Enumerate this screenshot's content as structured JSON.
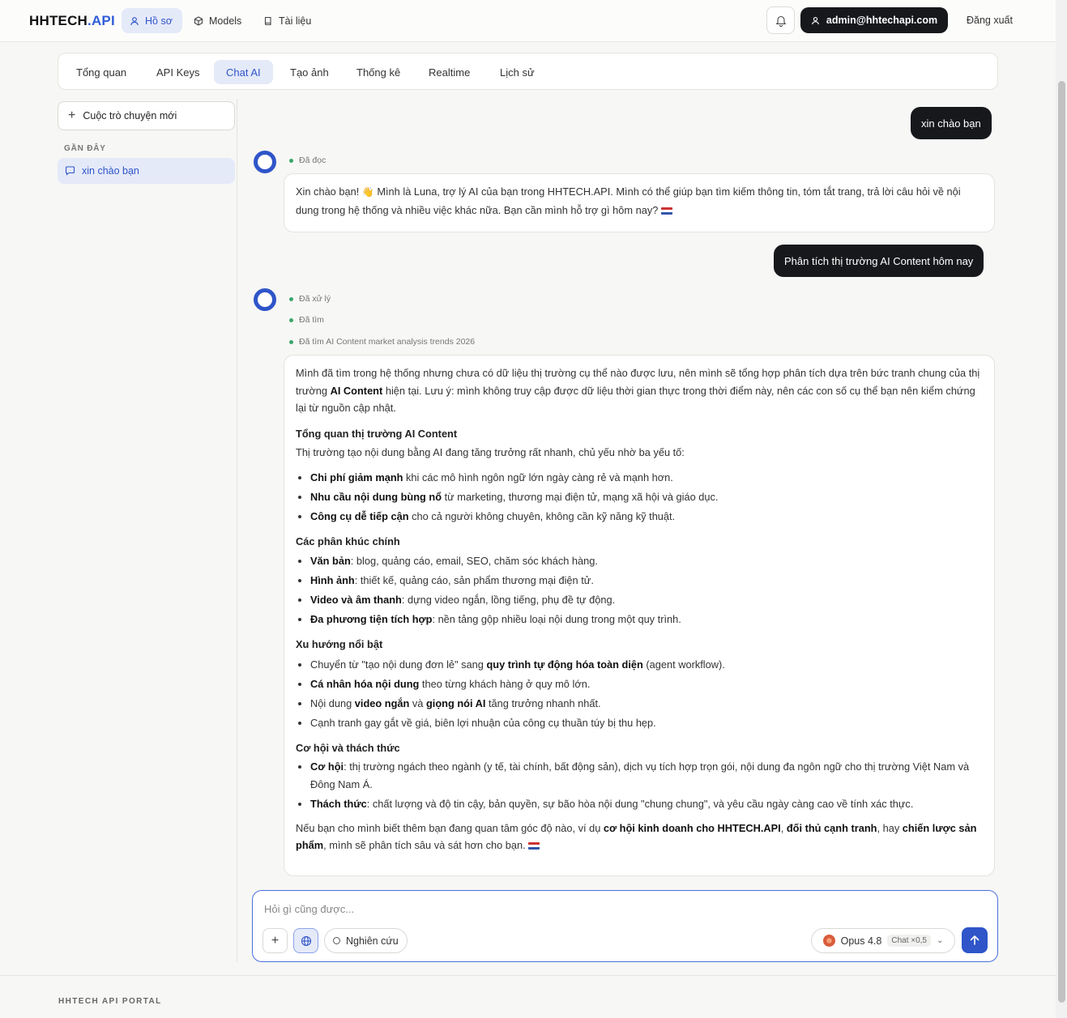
{
  "header": {
    "logo_main": "HHTECH",
    "logo_accent": ".API",
    "nav": [
      {
        "label": "Hồ sơ",
        "icon": "user-icon",
        "active": true
      },
      {
        "label": "Models",
        "icon": "cube-icon",
        "active": false
      },
      {
        "label": "Tài liệu",
        "icon": "book-icon",
        "active": false
      }
    ],
    "user_email": "admin@hhtechapi.com",
    "logout_label": "Đăng xuất"
  },
  "tabs": [
    {
      "label": "Tổng quan",
      "active": false
    },
    {
      "label": "API Keys",
      "active": false
    },
    {
      "label": "Chat AI",
      "active": true
    },
    {
      "label": "Tạo ảnh",
      "active": false
    },
    {
      "label": "Thống kê",
      "active": false
    },
    {
      "label": "Realtime",
      "active": false
    },
    {
      "label": "Lịch sử",
      "active": false
    }
  ],
  "sidebar": {
    "new_chat_label": "Cuộc trò chuyện mới",
    "recent_label": "GẦN ĐÂY",
    "recent_items": [
      "xin chào bạn"
    ]
  },
  "chat": {
    "user_msg_1": "xin chào bạn",
    "status_1": "Đã đọc",
    "assistant_1_a": "Xin chào bạn!",
    "assistant_1_b": "Mình là Luna, trợ lý AI của bạn trong HHTECH.API. Mình có thể giúp bạn tìm kiếm thông tin, tóm tắt trang, trả lời câu hỏi về nội dung trong hệ thống và nhiều việc khác nữa. Bạn cần mình hỗ trợ gì hôm nay?",
    "user_msg_2": "Phân tích thị trường AI Content hôm nay",
    "steps": [
      "Đã xử lý",
      "Đã tìm",
      "Đã tìm AI Content market analysis trends 2026"
    ],
    "answer": {
      "intro_1": "Mình đã tìm trong hệ thống nhưng chưa có dữ liệu thị trường cụ thể nào được lưu, nên mình sẽ tổng hợp phân tích dựa trên bức tranh chung của thị trường ",
      "intro_bold": "AI Content",
      "intro_2": " hiện tại. Lưu ý: mình không truy cập được dữ liệu thời gian thực trong thời điểm này, nên các con số cụ thể bạn nên kiểm chứng lại từ nguồn cập nhật.",
      "h1": "Tổng quan thị trường AI Content",
      "p1": "Thị trường tạo nội dung bằng AI đang tăng trưởng rất nhanh, chủ yếu nhờ ba yếu tố:",
      "l1": [
        {
          "b": "Chi phí giảm mạnh",
          "t": " khi các mô hình ngôn ngữ lớn ngày càng rẻ và mạnh hơn."
        },
        {
          "b": "Nhu cầu nội dung bùng nổ",
          "t": " từ marketing, thương mại điện tử, mạng xã hội và giáo dục."
        },
        {
          "b": "Công cụ dễ tiếp cận",
          "t": " cho cả người không chuyên, không cần kỹ năng kỹ thuật."
        }
      ],
      "h2": "Các phân khúc chính",
      "l2": [
        {
          "b": "Văn bản",
          "t": ": blog, quảng cáo, email, SEO, chăm sóc khách hàng."
        },
        {
          "b": "Hình ảnh",
          "t": ": thiết kế, quảng cáo, sản phẩm thương mại điện tử."
        },
        {
          "b": "Video và âm thanh",
          "t": ": dựng video ngắn, lồng tiếng, phụ đề tự động."
        },
        {
          "b": "Đa phương tiện tích hợp",
          "t": ": nền tảng gộp nhiều loại nội dung trong một quy trình."
        }
      ],
      "h3": "Xu hướng nổi bật",
      "l3_1a": "Chuyển từ \"tạo nội dung đơn lẻ\" sang ",
      "l3_1b": "quy trình tự động hóa toàn diện",
      "l3_1c": " (agent workflow).",
      "l3_2b": "Cá nhân hóa nội dung",
      "l3_2c": " theo từng khách hàng ở quy mô lớn.",
      "l3_3a": "Nội dung ",
      "l3_3b": "video ngắn",
      "l3_3c": " và ",
      "l3_3d": "giọng nói AI",
      "l3_3e": " tăng trưởng nhanh nhất.",
      "l3_4": "Cạnh tranh gay gắt về giá, biên lợi nhuận của công cụ thuần túy bị thu hẹp.",
      "h4": "Cơ hội và thách thức",
      "l4": [
        {
          "b": "Cơ hội",
          "t": ": thị trường ngách theo ngành (y tế, tài chính, bất động sản), dịch vụ tích hợp trọn gói, nội dung đa ngôn ngữ cho thị trường Việt Nam và Đông Nam Á."
        },
        {
          "b": "Thách thức",
          "t": ": chất lượng và độ tin cậy, bản quyền, sự bão hòa nội dung \"chung chung\", và yêu cầu ngày càng cao về tính xác thực."
        }
      ],
      "outro_1": "Nếu bạn cho mình biết thêm bạn đang quan tâm góc độ nào, ví dụ ",
      "outro_b1": "cơ hội kinh doanh cho HHTECH.API",
      "outro_2": ", ",
      "outro_b2": "đối thủ cạnh tranh",
      "outro_3": ", hay ",
      "outro_b3": "chiến lược sản phẩm",
      "outro_4": ", mình sẽ phân tích sâu và sát hơn cho bạn."
    }
  },
  "composer": {
    "placeholder": "Hỏi gì cũng được...",
    "research_label": "Nghiên cứu",
    "model_name": "Opus 4.8",
    "model_multiplier": "Chat ×0,5"
  },
  "footer": {
    "text": "HHTECH API PORTAL"
  },
  "colors": {
    "accent": "#2f55c9",
    "dark": "#16181c",
    "status_dot": "#3aa66a"
  }
}
